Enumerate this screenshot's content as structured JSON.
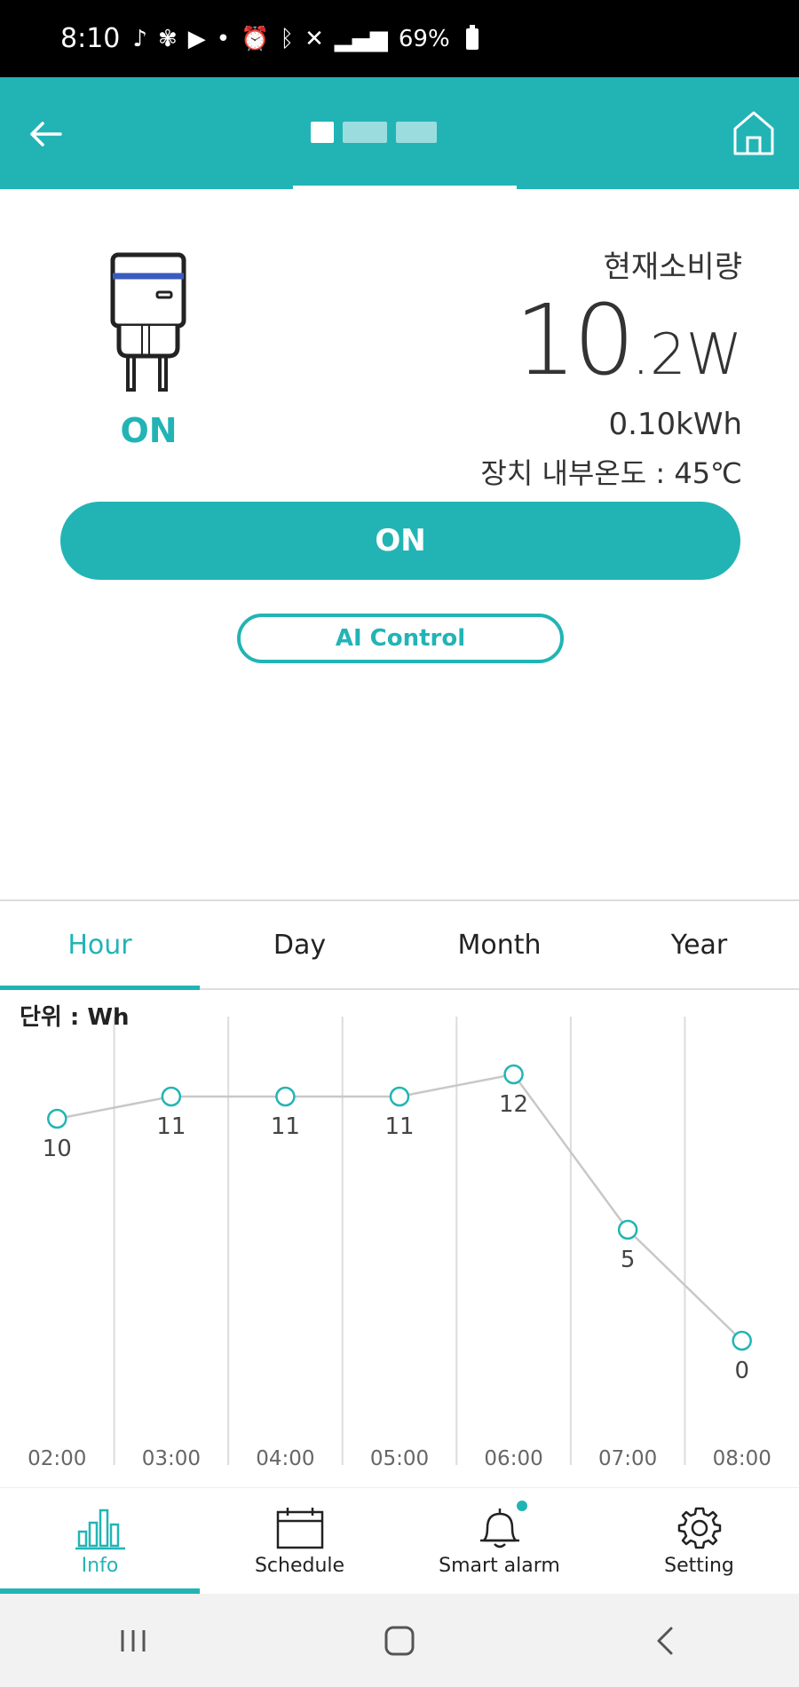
{
  "status_bar": {
    "time": "8:10",
    "battery": "69%"
  },
  "header": {
    "back_label": "back"
  },
  "device": {
    "status": "ON",
    "usage_label": "현재소비량",
    "watt_int": "10",
    "watt_dec": ".2W",
    "energy": "0.10kWh",
    "temperature": "장치 내부온도 : 45℃"
  },
  "buttons": {
    "power": "ON",
    "ai_control": "AI Control"
  },
  "period_tabs": [
    "Hour",
    "Day",
    "Month",
    "Year"
  ],
  "chart": {
    "unit": "단위 : Wh"
  },
  "chart_data": {
    "type": "line",
    "categories": [
      "02:00",
      "03:00",
      "04:00",
      "05:00",
      "06:00",
      "07:00",
      "08:00"
    ],
    "values": [
      10,
      11,
      11,
      11,
      12,
      5,
      0
    ],
    "ylabel": "단위 : Wh",
    "ylim": [
      0,
      12
    ],
    "grid": "vertical",
    "color": "#22b4b5"
  },
  "nav": {
    "info": "Info",
    "schedule": "Schedule",
    "smart_alarm": "Smart alarm",
    "setting": "Setting"
  },
  "colors": {
    "accent": "#22b4b5"
  }
}
